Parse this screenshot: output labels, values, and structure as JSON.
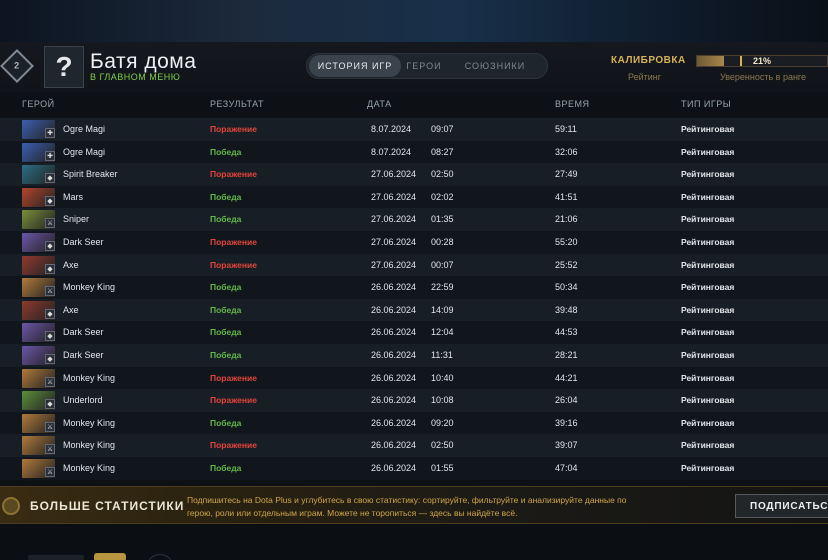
{
  "header": {
    "emblem_label": "2",
    "avatar_glyph": "?",
    "player_name": "Батя дома",
    "player_status": "В ГЛАВНОМ МЕНЮ",
    "tabs": [
      {
        "label": "ИСТОРИЯ ИГР",
        "active": true
      },
      {
        "label": "ГЕРОИ",
        "active": false
      },
      {
        "label": "СОЮЗНИКИ",
        "active": false
      }
    ],
    "calibration_label": "КАЛИБРОВКА",
    "rating_label": "Рейтинг",
    "confidence_value": "21%",
    "confidence_fraction": 0.21,
    "confidence_label": "Уверенность в ранге"
  },
  "table": {
    "columns": {
      "hero": "ГЕРОЙ",
      "result": "РЕЗУЛЬТАТ",
      "date": "ДАТА",
      "duration": "ВРЕМЯ",
      "mode": "ТИП ИГРЫ"
    },
    "rows": [
      {
        "hero": "Ogre Magi",
        "result": "Поражение",
        "outcome": "lose",
        "date": "8.07.2024",
        "time": "09:07",
        "duration": "59:11",
        "mode": "Рейтинговая",
        "color": "#3b5fb0",
        "role_icon": "support-icon"
      },
      {
        "hero": "Ogre Magi",
        "result": "Победа",
        "outcome": "win",
        "date": "8.07.2024",
        "time": "08:27",
        "duration": "32:06",
        "mode": "Рейтинговая",
        "color": "#3b5fb0",
        "role_icon": "support-icon"
      },
      {
        "hero": "Spirit Breaker",
        "result": "Поражение",
        "outcome": "lose",
        "date": "27.06.2024",
        "time": "02:50",
        "duration": "27:49",
        "mode": "Рейтинговая",
        "color": "#2b6f86",
        "role_icon": "offlane-icon"
      },
      {
        "hero": "Mars",
        "result": "Победа",
        "outcome": "win",
        "date": "27.06.2024",
        "time": "02:02",
        "duration": "41:51",
        "mode": "Рейтинговая",
        "color": "#b2452b",
        "role_icon": "offlane-icon"
      },
      {
        "hero": "Sniper",
        "result": "Победа",
        "outcome": "win",
        "date": "27.06.2024",
        "time": "01:35",
        "duration": "21:06",
        "mode": "Рейтинговая",
        "color": "#7a8f3a",
        "role_icon": "carry-icon"
      },
      {
        "hero": "Dark Seer",
        "result": "Поражение",
        "outcome": "lose",
        "date": "27.06.2024",
        "time": "00:28",
        "duration": "55:20",
        "mode": "Рейтинговая",
        "color": "#6b56a8",
        "role_icon": "offlane-icon"
      },
      {
        "hero": "Axe",
        "result": "Поражение",
        "outcome": "lose",
        "date": "27.06.2024",
        "time": "00:07",
        "duration": "25:52",
        "mode": "Рейтинговая",
        "color": "#8f3a2e",
        "role_icon": "offlane-icon"
      },
      {
        "hero": "Monkey King",
        "result": "Победа",
        "outcome": "win",
        "date": "26.06.2024",
        "time": "22:59",
        "duration": "50:34",
        "mode": "Рейтинговая",
        "color": "#b07a3b",
        "role_icon": "carry-icon"
      },
      {
        "hero": "Axe",
        "result": "Победа",
        "outcome": "win",
        "date": "26.06.2024",
        "time": "14:09",
        "duration": "39:48",
        "mode": "Рейтинговая",
        "color": "#8f3a2e",
        "role_icon": "offlane-icon"
      },
      {
        "hero": "Dark Seer",
        "result": "Победа",
        "outcome": "win",
        "date": "26.06.2024",
        "time": "12:04",
        "duration": "44:53",
        "mode": "Рейтинговая",
        "color": "#6b56a8",
        "role_icon": "offlane-icon"
      },
      {
        "hero": "Dark Seer",
        "result": "Победа",
        "outcome": "win",
        "date": "26.06.2024",
        "time": "11:31",
        "duration": "28:21",
        "mode": "Рейтинговая",
        "color": "#6b56a8",
        "role_icon": "offlane-icon"
      },
      {
        "hero": "Monkey King",
        "result": "Поражение",
        "outcome": "lose",
        "date": "26.06.2024",
        "time": "10:40",
        "duration": "44:21",
        "mode": "Рейтинговая",
        "color": "#b07a3b",
        "role_icon": "carry-icon"
      },
      {
        "hero": "Underlord",
        "result": "Поражение",
        "outcome": "lose",
        "date": "26.06.2024",
        "time": "10:08",
        "duration": "26:04",
        "mode": "Рейтинговая",
        "color": "#5b8f3a",
        "role_icon": "offlane-icon"
      },
      {
        "hero": "Monkey King",
        "result": "Победа",
        "outcome": "win",
        "date": "26.06.2024",
        "time": "09:20",
        "duration": "39:16",
        "mode": "Рейтинговая",
        "color": "#b07a3b",
        "role_icon": "carry-icon"
      },
      {
        "hero": "Monkey King",
        "result": "Поражение",
        "outcome": "lose",
        "date": "26.06.2024",
        "time": "02:50",
        "duration": "39:07",
        "mode": "Рейтинговая",
        "color": "#b07a3b",
        "role_icon": "carry-icon"
      },
      {
        "hero": "Monkey King",
        "result": "Победа",
        "outcome": "win",
        "date": "26.06.2024",
        "time": "01:55",
        "duration": "47:04",
        "mode": "Рейтинговая",
        "color": "#b07a3b",
        "role_icon": "carry-icon"
      }
    ]
  },
  "promo": {
    "icon": "dota-plus-icon",
    "title": "БОЛЬШЕ СТАТИСТИКИ",
    "text": "Подпишитесь на Dota Plus и углубитесь в свою статистику: сортируйте, фильтруйте и анализируйте данные по герою, роли или отдельным играм. Можете не торопиться — здесь вы найдёте всё.",
    "button_label": "ПОДПИСАТЬСЯ"
  },
  "colors": {
    "win": "#62b84a",
    "lose": "#e2453a",
    "gold": "#d6b25a"
  }
}
